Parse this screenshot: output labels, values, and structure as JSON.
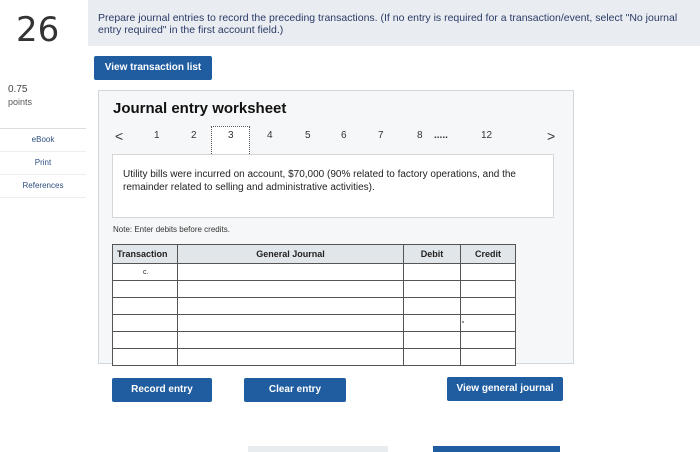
{
  "question": {
    "number": "26",
    "instructions": "Prepare journal entries to record the preceding transactions. (If no entry is required for a transaction/event, select \"No journal entry required\" in the first account field.)",
    "points_value": "0.75",
    "points_label": "points"
  },
  "sidebar": {
    "items": [
      "eBook",
      "Print",
      "References"
    ]
  },
  "buttons": {
    "view_transaction_list": "View transaction list",
    "record_entry": "Record entry",
    "clear_entry": "Clear entry",
    "view_general_journal": "View general journal"
  },
  "worksheet": {
    "title": "Journal entry worksheet",
    "pager": {
      "prev": "<",
      "pages": [
        "1",
        "2",
        "3",
        "4",
        "5",
        "6",
        "7",
        "8",
        ".....",
        "12"
      ],
      "next": ">",
      "current": "3"
    },
    "scenario": "Utility bills were incurred on account, $70,000 (90% related to factory operations, and the remainder related to selling and administrative activities).",
    "note": "Note: Enter debits before credits.",
    "table": {
      "headers": [
        "Transaction",
        "General Journal",
        "Debit",
        "Credit"
      ],
      "rows": [
        [
          "c.",
          "",
          "",
          ""
        ],
        [
          "",
          "",
          "",
          ""
        ],
        [
          "",
          "",
          "",
          ""
        ],
        [
          "",
          "",
          "",
          ""
        ],
        [
          "",
          "",
          "",
          ""
        ],
        [
          "",
          "",
          "",
          ""
        ]
      ]
    }
  },
  "colors": {
    "accent": "#1f5ca0",
    "header_bg": "#e9edf1"
  }
}
